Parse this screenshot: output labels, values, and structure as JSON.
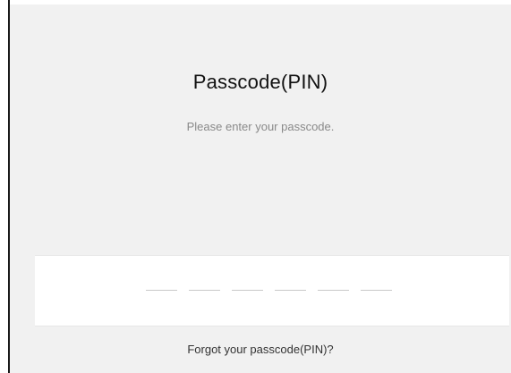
{
  "passcode": {
    "title": "Passcode(PIN)",
    "instruction": "Please enter your passcode.",
    "pin_length": 6,
    "entered_digits": 0,
    "forgot_link": "Forgot your passcode(PIN)?"
  },
  "colors": {
    "panel_background": "#f1f1f1",
    "input_background": "#ffffff",
    "slot_line": "#c8c8c8",
    "title_text": "#111111",
    "subtitle_text": "#8a8a8a"
  }
}
